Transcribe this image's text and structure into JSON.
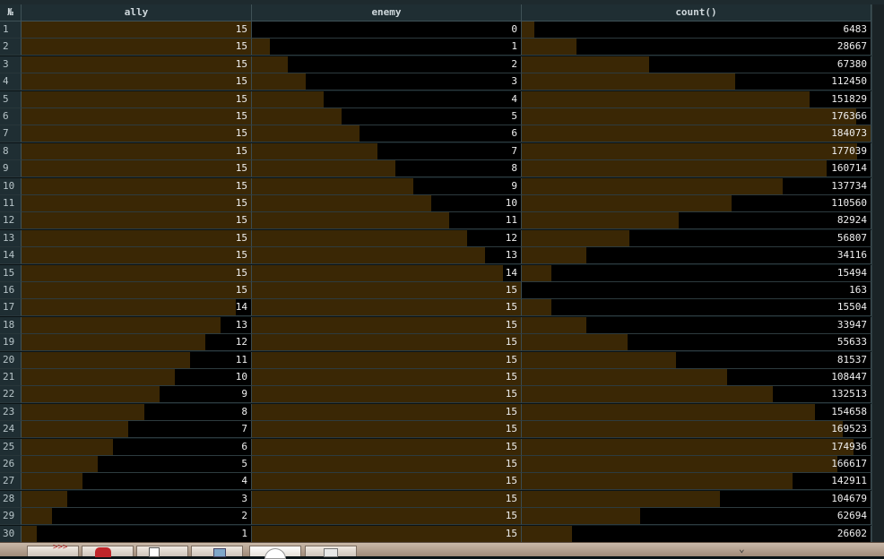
{
  "table": {
    "index_header": "№",
    "columns": [
      {
        "key": "ally",
        "label": "ally",
        "max": 15
      },
      {
        "key": "enemy",
        "label": "enemy",
        "max": 15
      },
      {
        "key": "count",
        "label": "count()",
        "max": 184073
      }
    ],
    "rows": [
      {
        "n": "1",
        "ally": 15,
        "enemy": 0,
        "count": 6483
      },
      {
        "n": "2",
        "ally": 15,
        "enemy": 1,
        "count": 28667
      },
      {
        "n": "3",
        "ally": 15,
        "enemy": 2,
        "count": 67380
      },
      {
        "n": "4",
        "ally": 15,
        "enemy": 3,
        "count": 112450
      },
      {
        "n": "5",
        "ally": 15,
        "enemy": 4,
        "count": 151829
      },
      {
        "n": "6",
        "ally": 15,
        "enemy": 5,
        "count": 176366
      },
      {
        "n": "7",
        "ally": 15,
        "enemy": 6,
        "count": 184073
      },
      {
        "n": "8",
        "ally": 15,
        "enemy": 7,
        "count": 177039
      },
      {
        "n": "9",
        "ally": 15,
        "enemy": 8,
        "count": 160714
      },
      {
        "n": "10",
        "ally": 15,
        "enemy": 9,
        "count": 137734
      },
      {
        "n": "11",
        "ally": 15,
        "enemy": 10,
        "count": 110560
      },
      {
        "n": "12",
        "ally": 15,
        "enemy": 11,
        "count": 82924
      },
      {
        "n": "13",
        "ally": 15,
        "enemy": 12,
        "count": 56807
      },
      {
        "n": "14",
        "ally": 15,
        "enemy": 13,
        "count": 34116
      },
      {
        "n": "15",
        "ally": 15,
        "enemy": 14,
        "count": 15494
      },
      {
        "n": "16",
        "ally": 15,
        "enemy": 15,
        "count": 163
      },
      {
        "n": "17",
        "ally": 14,
        "enemy": 15,
        "count": 15504
      },
      {
        "n": "18",
        "ally": 13,
        "enemy": 15,
        "count": 33947
      },
      {
        "n": "19",
        "ally": 12,
        "enemy": 15,
        "count": 55633
      },
      {
        "n": "20",
        "ally": 11,
        "enemy": 15,
        "count": 81537
      },
      {
        "n": "21",
        "ally": 10,
        "enemy": 15,
        "count": 108447
      },
      {
        "n": "22",
        "ally": 9,
        "enemy": 15,
        "count": 132513
      },
      {
        "n": "23",
        "ally": 8,
        "enemy": 15,
        "count": 154658
      },
      {
        "n": "24",
        "ally": 7,
        "enemy": 15,
        "count": 169523
      },
      {
        "n": "25",
        "ally": 6,
        "enemy": 15,
        "count": 174936
      },
      {
        "n": "26",
        "ally": 5,
        "enemy": 15,
        "count": 166617
      },
      {
        "n": "27",
        "ally": 4,
        "enemy": 15,
        "count": 142911
      },
      {
        "n": "28",
        "ally": 3,
        "enemy": 15,
        "count": 104679
      },
      {
        "n": "29",
        "ally": 2,
        "enemy": 15,
        "count": 62694
      },
      {
        "n": "30",
        "ally": 1,
        "enemy": 15,
        "count": 26602
      }
    ]
  },
  "taskbar": {
    "button_label": ">>>",
    "chevron": "⌄"
  }
}
